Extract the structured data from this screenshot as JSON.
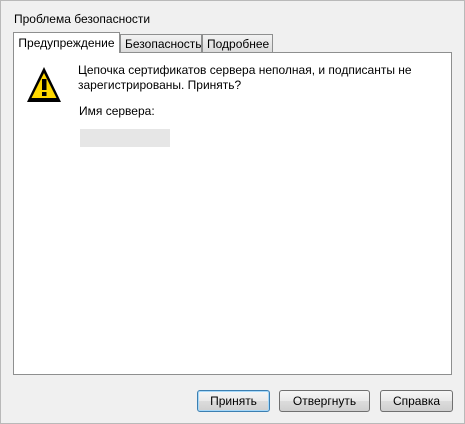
{
  "window": {
    "title": "Проблема безопасности"
  },
  "tabs": [
    {
      "label": "Предупреждение",
      "active": true
    },
    {
      "label": "Безопасность",
      "active": false
    },
    {
      "label": "Подробнее",
      "active": false
    }
  ],
  "warning": {
    "icon": "warning-triangle-icon",
    "message": "Цепочка сертификатов сервера неполная, и подписанты не зарегистрированы. Принять?",
    "server_label": "Имя сервера:",
    "server_value": ""
  },
  "buttons": {
    "accept": "Принять",
    "reject": "Отвергнуть",
    "help": "Справка"
  },
  "colors": {
    "warning_fill": "#ffd800",
    "warning_stroke": "#000000"
  }
}
